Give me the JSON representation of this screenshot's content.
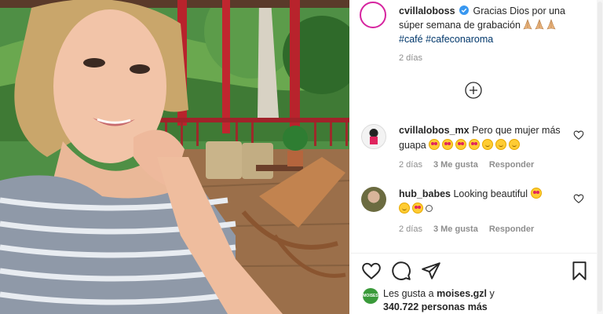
{
  "post": {
    "author": "cvillaloboss",
    "caption_text": "Gracias Dios por una súper semana de grabación",
    "caption_emojis": [
      "folded-hands",
      "folded-hands",
      "folded-hands"
    ],
    "hashtags": [
      "#café",
      "#cafeconaroma"
    ],
    "time": "2 días",
    "verified": true
  },
  "comments": [
    {
      "user": "cvillalobos_mx",
      "text": "Pero que mujer más guapa",
      "emojis": [
        "heart-eyes",
        "heart-eyes",
        "heart-eyes",
        "heart-eyes",
        "smiling-face",
        "smiling-face",
        "smiling-face"
      ],
      "time": "2 días",
      "likes": "3 Me gusta",
      "reply": "Responder"
    },
    {
      "user": "hub_babes",
      "text": "Looking beautiful",
      "emojis": [
        "heart-eyes",
        "smiling-face",
        "heart-eyes",
        "face"
      ],
      "time": "2 días",
      "likes": "3 Me gusta",
      "reply": "Responder"
    }
  ],
  "likes": {
    "prefix": "Les gusta a",
    "user": "moises.gzl",
    "suffix": "y",
    "count": "340.722 personas más",
    "avatar_text": "MOISES"
  },
  "icons": {
    "like": "heart-outline-icon",
    "comment": "comment-bubble-icon",
    "share": "paper-plane-icon",
    "save": "bookmark-icon",
    "load_more": "plus-circle-icon"
  },
  "colors": {
    "text": "#262626",
    "secondary": "#8e8e8e",
    "hashtag": "#00376b",
    "verified": "#3897f0",
    "story_ring": "#d6249f"
  }
}
